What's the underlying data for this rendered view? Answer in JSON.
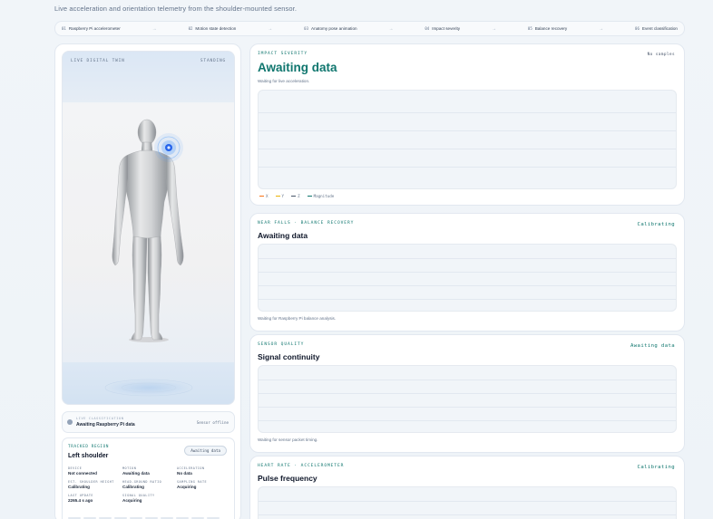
{
  "subtitle": "Live acceleration and orientation telemetry from the shoulder-mounted sensor.",
  "pipeline": [
    {
      "num": "01",
      "label": "Raspberry Pi accelerometer"
    },
    {
      "num": "02",
      "label": "Motion state detection"
    },
    {
      "num": "03",
      "label": "Anatomy pose animation"
    },
    {
      "num": "04",
      "label": "Impact severity"
    },
    {
      "num": "05",
      "label": "Balance recovery"
    },
    {
      "num": "06",
      "label": "Event classification"
    }
  ],
  "arrow_glyph": "→",
  "twin": {
    "label": "LIVE DIGITAL TWIN",
    "state": "STANDING",
    "accent": "#3b82f6"
  },
  "classification": {
    "caption": "LIVE CLASSIFICATION",
    "value": "Awaiting Raspberry Pi data",
    "status": "Sensor offline"
  },
  "region": {
    "caption": "TRACKED REGION",
    "title": "Left shoulder",
    "badge": "Awaiting data",
    "fields": [
      {
        "k": "DEVICE",
        "v": "Not connected"
      },
      {
        "k": "MOTION",
        "v": "Awaiting data"
      },
      {
        "k": "ACCELERATION",
        "v": "No data"
      },
      {
        "k": "EST. SHOULDER HEIGHT",
        "v": "Calibrating"
      },
      {
        "k": "HEAD-GROUND RATIO",
        "v": "Calibrating"
      },
      {
        "k": "SAMPLING RATE",
        "v": "Acquiring"
      },
      {
        "k": "LAST UPDATE",
        "v": "2265.4 s ago"
      },
      {
        "k": "SIGNAL QUALITY",
        "v": "Acquiring"
      }
    ]
  },
  "impact": {
    "caption": "IMPACT SEVERITY",
    "status": "No samples",
    "title": "Awaiting data",
    "note": "Waiting for live acceleration.",
    "legend": [
      {
        "label": "X",
        "color": "#f97316"
      },
      {
        "label": "Y",
        "color": "#eab308"
      },
      {
        "label": "Z",
        "color": "#475569"
      },
      {
        "label": "Magnitude",
        "color": "#0f766e"
      }
    ]
  },
  "nearfalls": {
    "caption": "NEAR FALLS · BALANCE RECOVERY",
    "status": "Calibrating",
    "title": "Awaiting data",
    "note": "Waiting for Raspberry Pi balance analysis."
  },
  "sensor": {
    "caption": "SENSOR QUALITY",
    "status": "Awaiting data",
    "title": "Signal continuity",
    "note": "Waiting for sensor packet timing."
  },
  "heart": {
    "caption": "HEART RATE · ACCELEROMETER",
    "status": "Calibrating",
    "title": "Pulse frequency"
  }
}
